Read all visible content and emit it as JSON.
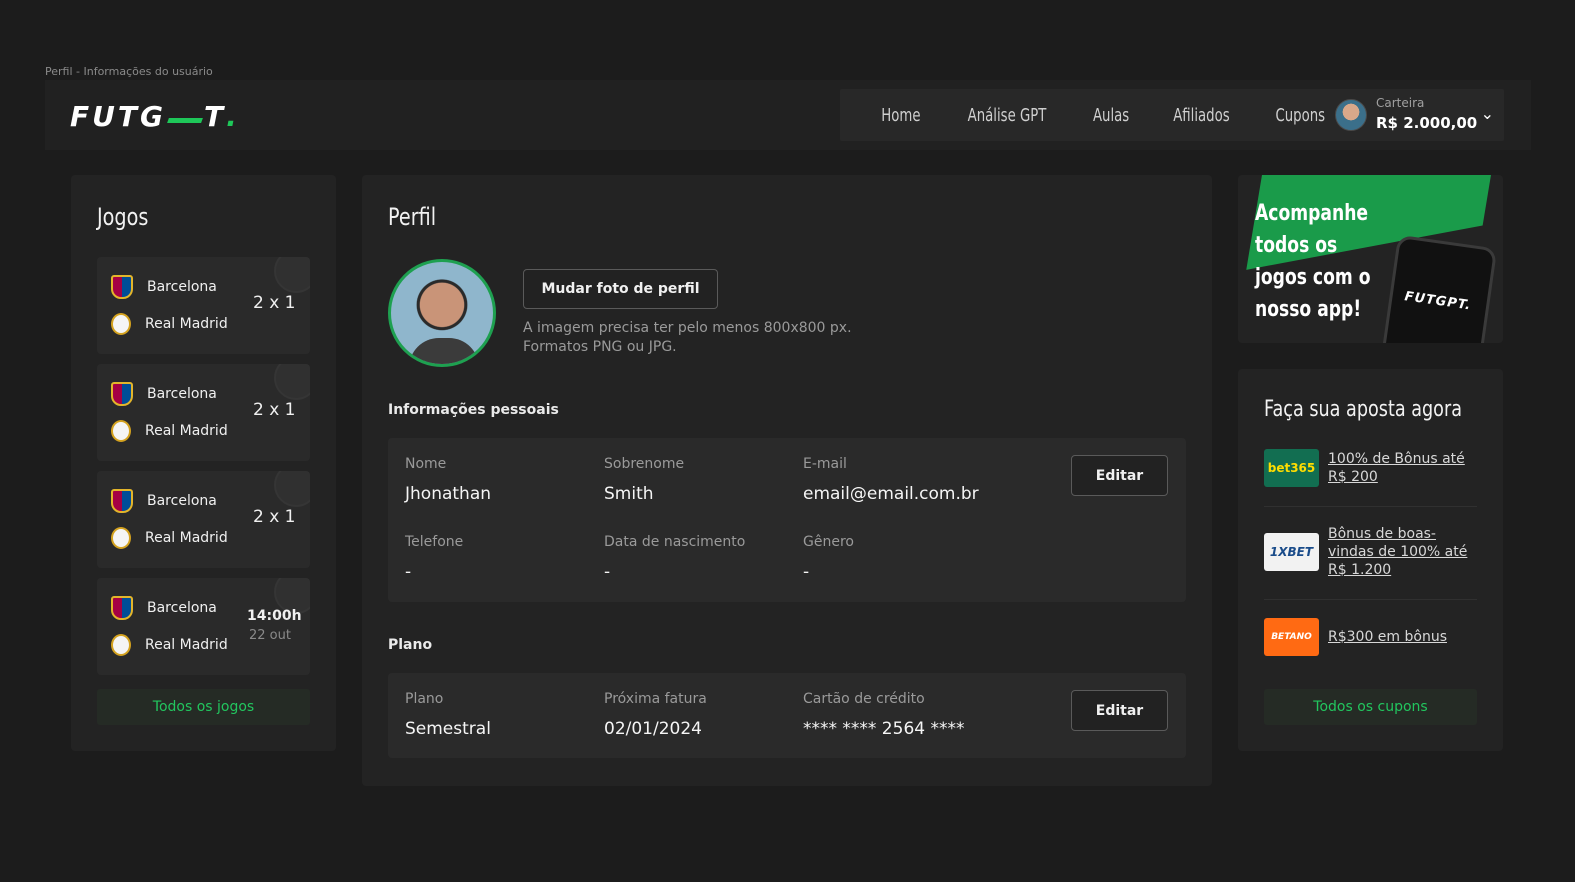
{
  "caption": "Perfil - Informações do usuário",
  "header": {
    "logo_text": "FUTGPT",
    "nav": [
      "Home",
      "Análise GPT",
      "Aulas",
      "Afiliados",
      "Cupons"
    ],
    "wallet_label": "Carteira",
    "wallet_value": "R$ 2.000,00"
  },
  "games": {
    "title": "Jogos",
    "items": [
      {
        "home": "Barcelona",
        "away": "Real Madrid",
        "score": "2 x 1"
      },
      {
        "home": "Barcelona",
        "away": "Real Madrid",
        "score": "2 x 1"
      },
      {
        "home": "Barcelona",
        "away": "Real Madrid",
        "score": "2 x 1"
      },
      {
        "home": "Barcelona",
        "away": "Real Madrid",
        "time": "14:00h",
        "date": "22 out"
      }
    ],
    "all_label": "Todos os jogos"
  },
  "profile": {
    "title": "Perfil",
    "change_photo_label": "Mudar foto de perfil",
    "hint_line1": "A imagem precisa ter pelo menos 800x800 px.",
    "hint_line2": "Formatos PNG ou JPG.",
    "personal_title": "Informações pessoais",
    "fields": {
      "nome_k": "Nome",
      "nome_v": "Jhonathan",
      "sobrenome_k": "Sobrenome",
      "sobrenome_v": "Smith",
      "email_k": "E-mail",
      "email_v": "email@email.com.br",
      "telefone_k": "Telefone",
      "telefone_v": "-",
      "nasc_k": "Data de nascimento",
      "nasc_v": "-",
      "genero_k": "Gênero",
      "genero_v": "-"
    },
    "edit_label": "Editar",
    "plan_title": "Plano",
    "plan": {
      "plano_k": "Plano",
      "plano_v": "Semestral",
      "fatura_k": "Próxima fatura",
      "fatura_v": "02/01/2024",
      "cartao_k": "Cartão de crédito",
      "cartao_v": "**** **** 2564 ****"
    }
  },
  "promo": {
    "text_line1": "Acompanhe",
    "text_line2": "todos os",
    "text_line3": "jogos com o",
    "text_line4": "nosso app!",
    "phone_logo": "FUTGPT."
  },
  "bets": {
    "title": "Faça sua aposta agora",
    "items": [
      {
        "brand": "bet365",
        "offer": "100% de Bônus até R$ 200",
        "color": "#126e51"
      },
      {
        "brand": "1XBET",
        "offer": "Bônus de boas-vindas de 100% até R$ 1.200",
        "color": "#f2f2f2"
      },
      {
        "brand": "BETANO",
        "offer": "R$300 em bônus",
        "color": "#ff6a13"
      }
    ],
    "all_label": "Todos os cupons"
  }
}
